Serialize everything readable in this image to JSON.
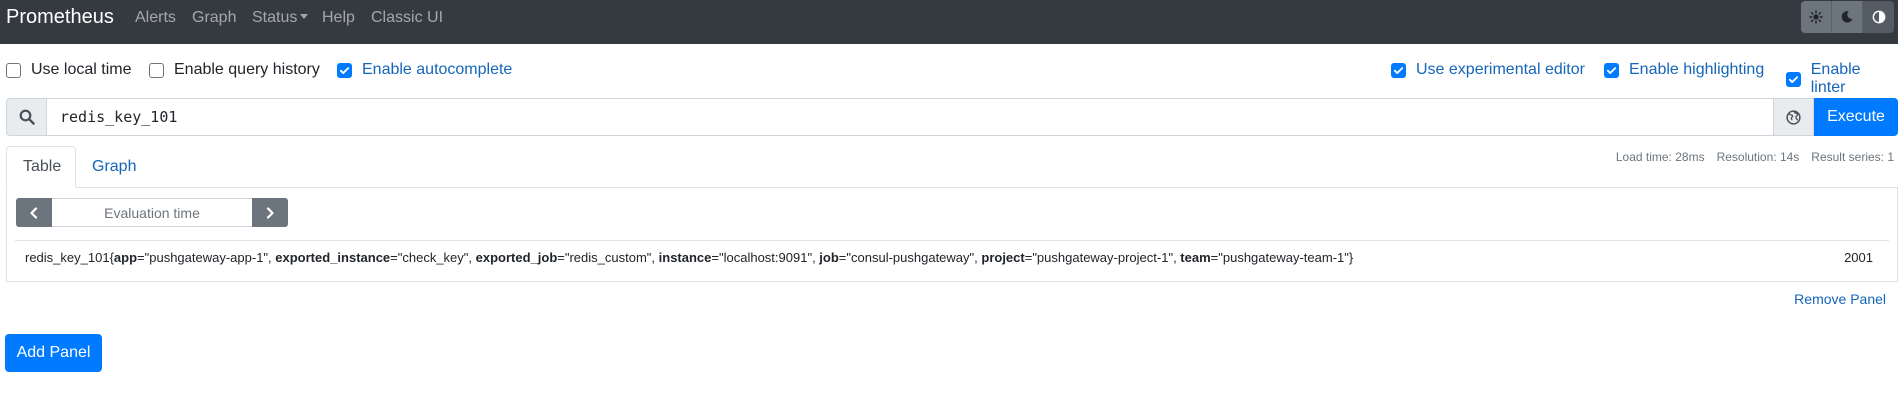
{
  "nav": {
    "brand": "Prometheus",
    "links": [
      "Alerts",
      "Graph",
      "Status",
      "Help",
      "Classic UI"
    ],
    "theme_buttons": [
      "light-theme-icon",
      "dark-theme-icon",
      "auto-theme-icon"
    ]
  },
  "options": {
    "use_local_time": {
      "label": "Use local time",
      "checked": false
    },
    "enable_query_history": {
      "label": "Enable query history",
      "checked": false
    },
    "enable_autocomplete": {
      "label": "Enable autocomplete",
      "checked": true
    },
    "use_experimental_editor": {
      "label": "Use experimental editor",
      "checked": true
    },
    "enable_highlighting": {
      "label": "Enable highlighting",
      "checked": true
    },
    "enable_linter": {
      "label": "Enable linter",
      "checked": true
    }
  },
  "query": {
    "value": "redis_key_101",
    "execute_label": "Execute"
  },
  "tabs": {
    "table": "Table",
    "graph": "Graph"
  },
  "stats": {
    "load_time": "Load time: 28ms",
    "resolution": "Resolution: 14s",
    "result_series": "Result series: 1"
  },
  "panel": {
    "eval_placeholder": "Evaluation time",
    "result": {
      "metric": "redis_key_101",
      "labels": [
        {
          "key": "app",
          "value": "\"pushgateway-app-1\""
        },
        {
          "key": "exported_instance",
          "value": "\"check_key\""
        },
        {
          "key": "exported_job",
          "value": "\"redis_custom\""
        },
        {
          "key": "instance",
          "value": "\"localhost:9091\""
        },
        {
          "key": "job",
          "value": "\"consul-pushgateway\""
        },
        {
          "key": "project",
          "value": "\"pushgateway-project-1\""
        },
        {
          "key": "team",
          "value": "\"pushgateway-team-1\""
        }
      ],
      "value": "2001"
    },
    "remove_label": "Remove Panel"
  },
  "add_panel_label": "Add Panel",
  "colors": {
    "navbar": "#343a40",
    "primary": "#007bff",
    "link": "#1565b9",
    "secondary": "#6c757d"
  }
}
